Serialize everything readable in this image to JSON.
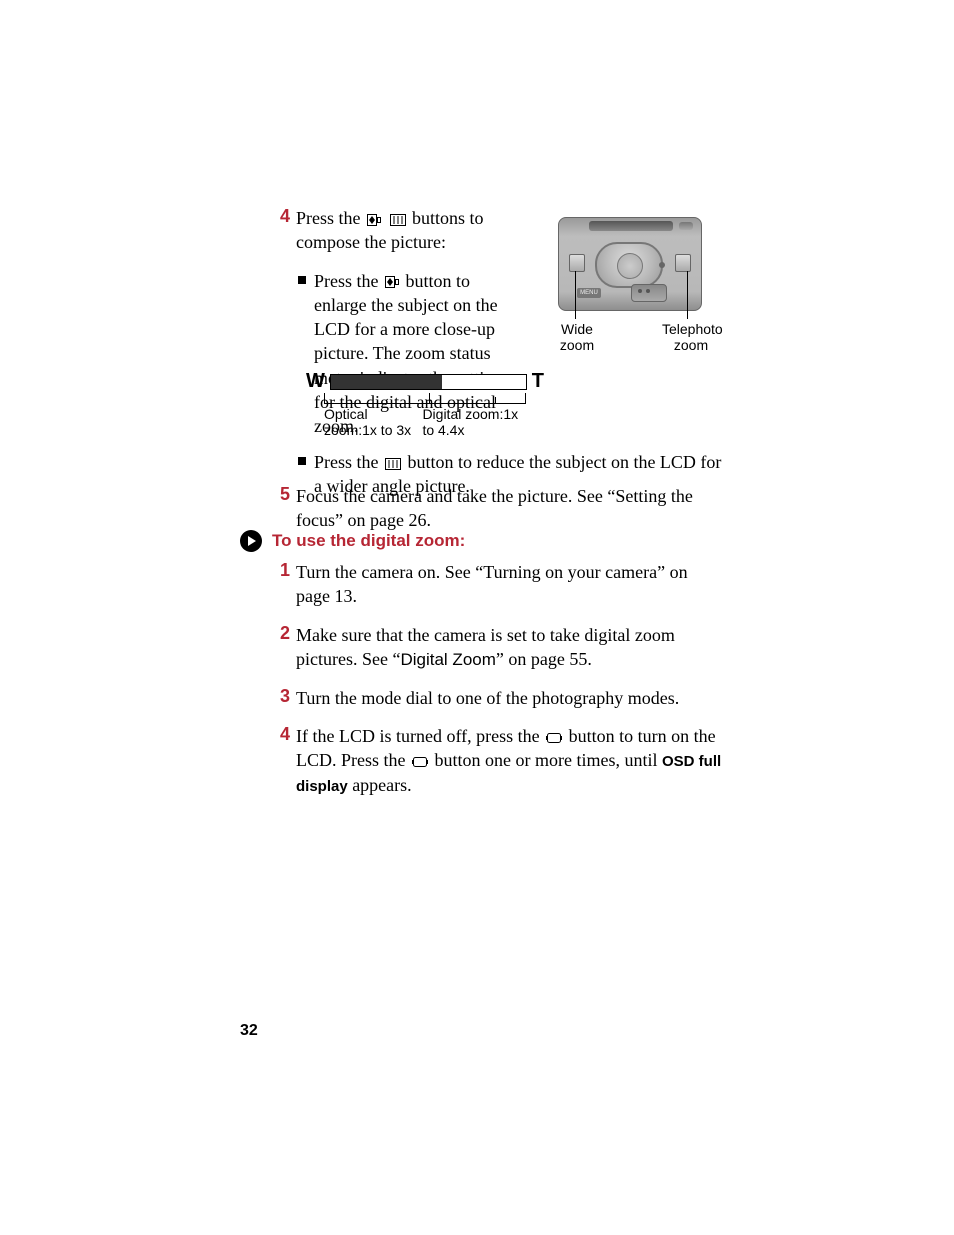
{
  "page_number": "32",
  "block1": {
    "step4_num": "4",
    "step4_a": "Press the ",
    "step4_b": " buttons to compose the picture:",
    "bullet_a": "Press the ",
    "bullet_b": " button to enlarge the subject on the LCD for a more close-up picture. The zoom status meter indicates the settings for the digital and optical zoom."
  },
  "camera": {
    "wide_label": "Wide zoom",
    "tele_label": "Telephoto zoom",
    "menu": "MENU"
  },
  "meter": {
    "W": "W",
    "T": "T",
    "optical": "Optical zoom:1x to 3x",
    "digital": "Digital zoom:1x to 4.4x"
  },
  "wide_bullet": {
    "a": "Press the ",
    "b": " button to reduce the subject on the LCD for a wider angle picture."
  },
  "step5": {
    "num": "5",
    "text": "Focus the camera and take the picture. See “Setting the focus” on page 26."
  },
  "heading": "To use the digital zoom:",
  "steps2": {
    "s1_num": "1",
    "s1_text": "Turn the camera on. See “Turning on your camera” on page 13.",
    "s2_num": "2",
    "s2_a": "Make sure that the camera is set to take digital zoom pictures. See “",
    "s2_alt": "Digital Zoom",
    "s2_b": "” on page 55.",
    "s3_num": "3",
    "s3_text": "Turn the mode dial to one of the photography modes.",
    "s4_num": "4",
    "s4_a": "If the LCD is turned off, press the ",
    "s4_b": " button to turn on the LCD. Press the ",
    "s4_c": " button one or more times, until ",
    "s4_osd": "OSD full display",
    "s4_d": " appears."
  }
}
